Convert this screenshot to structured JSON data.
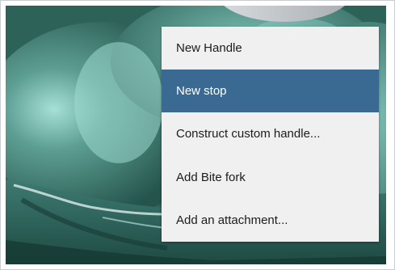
{
  "viewport": {
    "model_color": "#3f7c72",
    "highlight_color": "#8fd1c6",
    "shadow_color": "#173b35"
  },
  "context_menu": {
    "selected_index": 1,
    "selected_color": "#3a6a91",
    "items": [
      {
        "label": "New Handle"
      },
      {
        "label": "New stop"
      },
      {
        "label": "Construct custom handle..."
      },
      {
        "label": "Add Bite fork"
      },
      {
        "label": "Add an attachment..."
      }
    ]
  }
}
